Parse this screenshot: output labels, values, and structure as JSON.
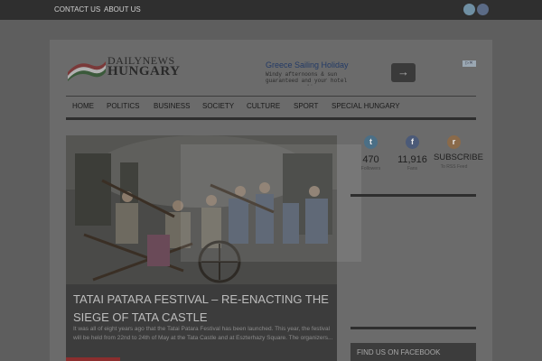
{
  "topbar": {
    "links": [
      "CONTACT US",
      "ABOUT US"
    ],
    "social": [
      "twitter-icon",
      "facebook-icon"
    ]
  },
  "logo": {
    "line1": "DAILYNEWS",
    "line2": "HUNGARY"
  },
  "ad": {
    "title": "Greece Sailing Holiday",
    "text": "Windy afternoons & sun guaranteed and your hotel",
    "dots": "▪ ▫",
    "button_icon": "arrow-right-icon",
    "button_glyph": "→",
    "badge": "▷✕"
  },
  "nav": {
    "items": [
      "HOME",
      "POLITICS",
      "BUSINESS",
      "SOCIETY",
      "CULTURE",
      "SPORT",
      "SPECIAL HUNGARY"
    ]
  },
  "hero": {
    "title": "TATAI PATARA FESTIVAL – RE-ENACTING THE SIEGE OF TATA CASTLE",
    "excerpt": "It was all of eight years ago that the Tatai Patara Festival has been launched. This year, the festival will be held from 22nd to 24th of May at the Tata Castle and at Eszterhazy Square. The organizers..."
  },
  "stats": [
    {
      "icon": "twitter-icon",
      "glyph": "t",
      "value": "470",
      "label": "Followers"
    },
    {
      "icon": "facebook-icon",
      "glyph": "f",
      "value": "11,916",
      "label": "Fans"
    },
    {
      "icon": "rss-icon",
      "glyph": "r",
      "value": "SUBSCRIBE",
      "label": "To RSS Feed"
    }
  ],
  "sidebar": {
    "facebook_box_title": "FIND US ON FACEBOOK"
  },
  "colors": {
    "topbar": "#2f2f2f",
    "background": "#5e5e5e",
    "content": "#6b6b6b",
    "nav_line": "#2e2e2e"
  }
}
